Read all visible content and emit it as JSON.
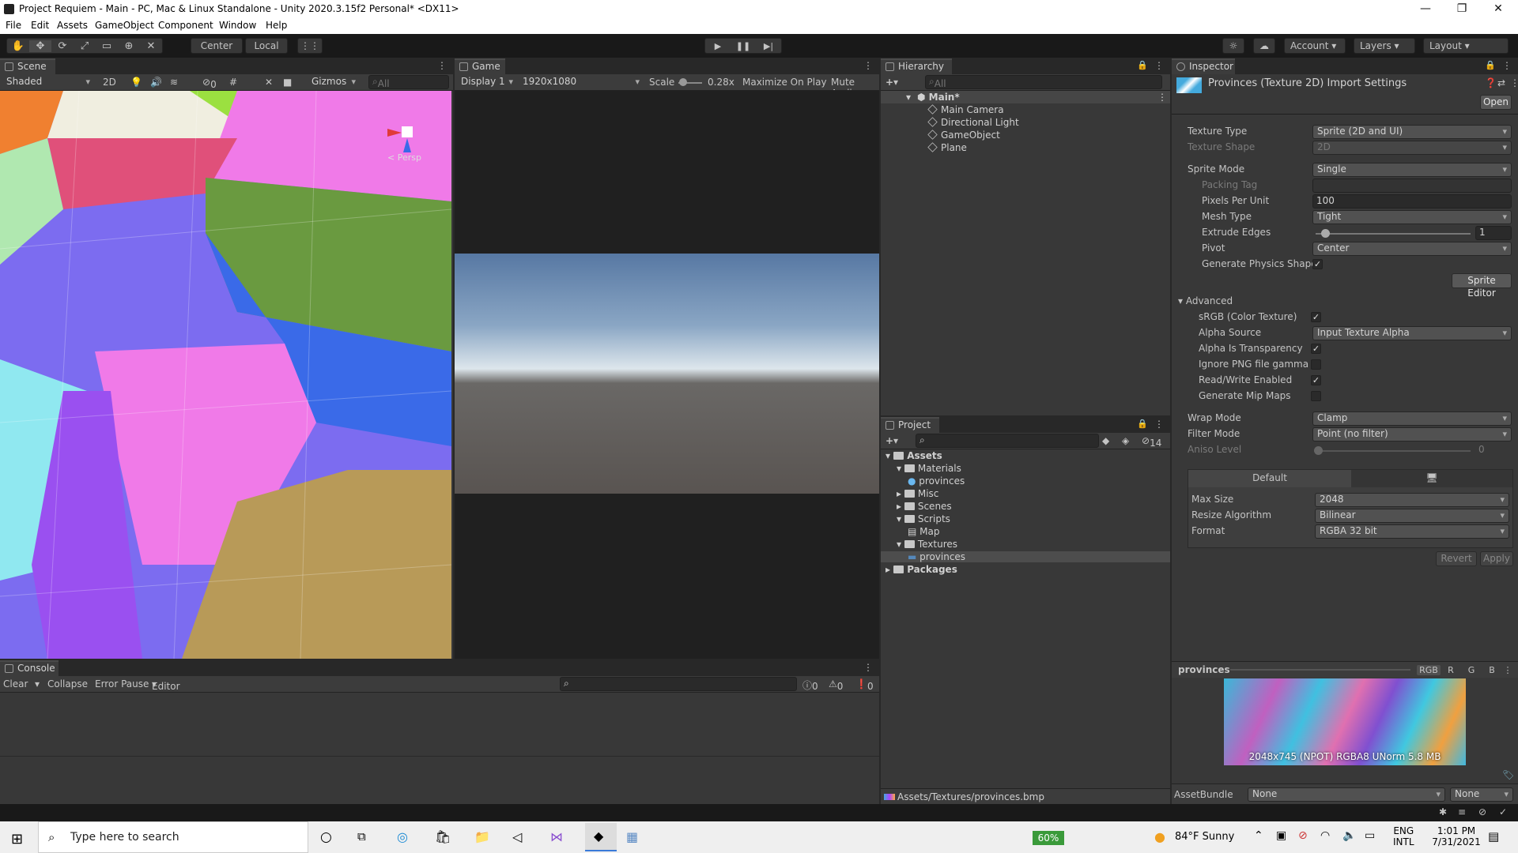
{
  "window": {
    "title": "Project Requiem - Main - PC, Mac & Linux Standalone - Unity 2020.3.15f2 Personal* <DX11>",
    "minimize": "—",
    "maximize": "❐",
    "close": "✕"
  },
  "menu": [
    "File",
    "Edit",
    "Assets",
    "GameObject",
    "Component",
    "Window",
    "Help"
  ],
  "toolbar": {
    "center": "Center",
    "local": "Local",
    "account": "Account",
    "layers": "Layers",
    "layout": "Layout"
  },
  "scene": {
    "tab": "Scene",
    "shading": "Shaded",
    "mode2d": "2D",
    "hidden_count": "0",
    "gizmos": "Gizmos",
    "search_placeholder": "All",
    "persp": "< Persp"
  },
  "game": {
    "tab": "Game",
    "display": "Display 1",
    "resolution": "1920x1080",
    "scale_label": "Scale",
    "scale_value": "0.28x",
    "maximize": "Maximize On Play",
    "mute": "Mute Audio"
  },
  "hierarchy": {
    "tab": "Hierarchy",
    "search_placeholder": "All",
    "scene": "Main*",
    "items": [
      "Main Camera",
      "Directional Light",
      "GameObject",
      "Plane"
    ]
  },
  "project": {
    "tab": "Project",
    "hidden_count": "14",
    "root": "Assets",
    "items": [
      {
        "label": "Materials",
        "depth": 1,
        "kind": "folder",
        "open": true
      },
      {
        "label": "provinces",
        "depth": 2,
        "kind": "material"
      },
      {
        "label": "Misc",
        "depth": 1,
        "kind": "folder"
      },
      {
        "label": "Scenes",
        "depth": 1,
        "kind": "folder"
      },
      {
        "label": "Scripts",
        "depth": 1,
        "kind": "folder",
        "open": true
      },
      {
        "label": "Map",
        "depth": 2,
        "kind": "script"
      },
      {
        "label": "Textures",
        "depth": 1,
        "kind": "folder",
        "open": true
      },
      {
        "label": "provinces",
        "depth": 2,
        "kind": "texture",
        "selected": true
      }
    ],
    "packages": "Packages",
    "path": "Assets/Textures/provinces.bmp"
  },
  "console": {
    "tab": "Console",
    "clear": "Clear",
    "collapse": "Collapse",
    "error_pause": "Error Pause",
    "editor": "Editor",
    "logs": "0",
    "warnings": "0",
    "errors": "0"
  },
  "inspector": {
    "tab": "Inspector",
    "title": "Provinces (Texture 2D) Import Settings",
    "open": "Open",
    "texture_type": {
      "label": "Texture Type",
      "value": "Sprite (2D and UI)"
    },
    "texture_shape": {
      "label": "Texture Shape",
      "value": "2D"
    },
    "sprite_mode": {
      "label": "Sprite Mode",
      "value": "Single"
    },
    "packing_tag": {
      "label": "Packing Tag",
      "value": ""
    },
    "ppu": {
      "label": "Pixels Per Unit",
      "value": "100"
    },
    "mesh_type": {
      "label": "Mesh Type",
      "value": "Tight"
    },
    "extrude": {
      "label": "Extrude Edges",
      "value": "1",
      "fraction": 0.0625
    },
    "pivot": {
      "label": "Pivot",
      "value": "Center"
    },
    "physics": {
      "label": "Generate Physics Shape",
      "checked": true
    },
    "sprite_editor": "Sprite Editor",
    "advanced": "Advanced",
    "srgb": {
      "label": "sRGB (Color Texture)",
      "checked": true
    },
    "alpha_source": {
      "label": "Alpha Source",
      "value": "Input Texture Alpha"
    },
    "alpha_transp": {
      "label": "Alpha Is Transparency",
      "checked": true
    },
    "ignore_gamma": {
      "label": "Ignore PNG file gamma",
      "checked": false
    },
    "readwrite": {
      "label": "Read/Write Enabled",
      "checked": true
    },
    "mipmaps": {
      "label": "Generate Mip Maps",
      "checked": false
    },
    "wrap": {
      "label": "Wrap Mode",
      "value": "Clamp"
    },
    "filter": {
      "label": "Filter Mode",
      "value": "Point (no filter)"
    },
    "aniso": {
      "label": "Aniso Level",
      "value": "0"
    },
    "platform_default": "Default",
    "max_size": {
      "label": "Max Size",
      "value": "2048"
    },
    "resize": {
      "label": "Resize Algorithm",
      "value": "Bilinear"
    },
    "format": {
      "label": "Format",
      "value": "RGBA 32 bit"
    },
    "revert": "Revert",
    "apply": "Apply",
    "preview": {
      "name": "provinces",
      "channels": [
        "RGB",
        "R",
        "G",
        "B"
      ],
      "info": "2048x745 (NPOT)  RGBA8 UNorm  5.8 MB"
    },
    "assetbundle": {
      "label": "AssetBundle",
      "value": "None",
      "variant": "None"
    }
  },
  "taskbar": {
    "search_placeholder": "Type here to search",
    "battery": "60%",
    "weather": "84°F  Sunny",
    "lang1": "ENG",
    "lang2": "INTL",
    "time": "1:01 PM",
    "date": "7/31/2021"
  }
}
